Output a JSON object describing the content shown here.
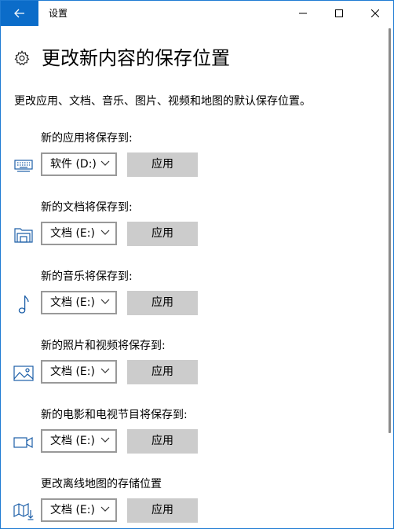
{
  "window": {
    "title": "设置"
  },
  "page": {
    "title": "更改新内容的保存位置",
    "description": "更改应用、文档、音乐、图片、视频和地图的默认保存位置。"
  },
  "sections": [
    {
      "label": "新的应用将保存到:",
      "drive": "软件 (D:)",
      "button": "应用",
      "icon": "monitor-icon"
    },
    {
      "label": "新的文档将保存到:",
      "drive": "文档 (E:)",
      "button": "应用",
      "icon": "document-folder-icon"
    },
    {
      "label": "新的音乐将保存到:",
      "drive": "文档 (E:)",
      "button": "应用",
      "icon": "music-note-icon"
    },
    {
      "label": "新的照片和视频将保存到:",
      "drive": "文档 (E:)",
      "button": "应用",
      "icon": "picture-icon"
    },
    {
      "label": "新的电影和电视节目将保存到:",
      "drive": "文档 (E:)",
      "button": "应用",
      "icon": "video-camera-icon"
    },
    {
      "label": "更改离线地图的存储位置",
      "drive": "文档 (E:)",
      "button": "应用",
      "icon": "map-download-icon"
    }
  ],
  "colors": {
    "accent": "#0b6cc9",
    "icon": "#1d5fa8",
    "button_bg": "#cccccc",
    "dropdown_border": "#999999"
  }
}
